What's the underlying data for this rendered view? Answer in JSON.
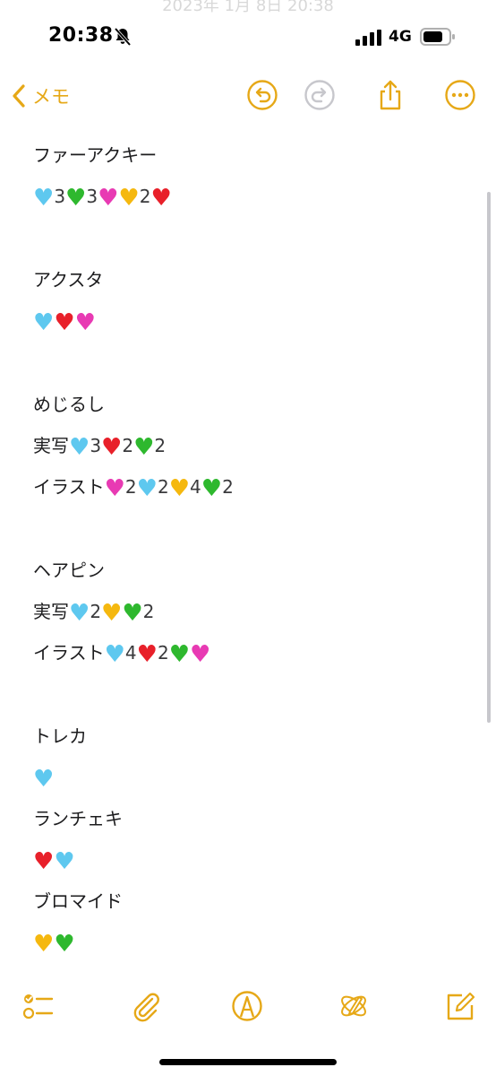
{
  "status_bar": {
    "time": "20:38",
    "network": "4G",
    "ghost_text": "2023年 1月 8日 20:38"
  },
  "nav": {
    "back_label": "メモ"
  },
  "colors": {
    "accent": "#e6a817",
    "heart_blue": "#5ec8ef",
    "heart_green": "#2eb82e",
    "heart_pink": "#e83ab3",
    "heart_yellow": "#f5b80f",
    "heart_red": "#e8202a"
  },
  "note": {
    "lines": [
      {
        "id": "l1",
        "text": "ファーアクキー"
      },
      {
        "id": "l2",
        "parts": [
          {
            "h": "blue"
          },
          {
            "n": "3"
          },
          {
            "h": "green"
          },
          {
            "n": "3"
          },
          {
            "h": "pink"
          },
          {
            "h": "yellow"
          },
          {
            "n": "2"
          },
          {
            "h": "red"
          }
        ]
      },
      {
        "id": "l3",
        "text": "アクスタ"
      },
      {
        "id": "l4",
        "parts": [
          {
            "h": "blue"
          },
          {
            "h": "red"
          },
          {
            "h": "pink"
          }
        ]
      },
      {
        "id": "l5",
        "text": "めじるし"
      },
      {
        "id": "l6",
        "label": "実写",
        "parts": [
          {
            "h": "blue"
          },
          {
            "n": "3"
          },
          {
            "h": "red"
          },
          {
            "n": "2"
          },
          {
            "h": "green"
          },
          {
            "n": "2"
          }
        ]
      },
      {
        "id": "l7",
        "label": "イラスト",
        "parts": [
          {
            "h": "pink"
          },
          {
            "n": "2"
          },
          {
            "h": "blue"
          },
          {
            "n": "2"
          },
          {
            "h": "yellow"
          },
          {
            "n": "4"
          },
          {
            "h": "green"
          },
          {
            "n": "2"
          }
        ]
      },
      {
        "id": "l8",
        "text": "ヘアピン"
      },
      {
        "id": "l9",
        "label": "実写",
        "parts": [
          {
            "h": "blue"
          },
          {
            "n": "2"
          },
          {
            "h": "yellow"
          },
          {
            "h": "green"
          },
          {
            "n": "2"
          }
        ]
      },
      {
        "id": "l10",
        "label": "イラスト",
        "parts": [
          {
            "h": "blue"
          },
          {
            "n": "4"
          },
          {
            "h": "red"
          },
          {
            "n": "2"
          },
          {
            "h": "green"
          },
          {
            "h": "pink"
          }
        ]
      },
      {
        "id": "l11",
        "text": "トレカ"
      },
      {
        "id": "l12",
        "parts": [
          {
            "h": "blue"
          }
        ]
      },
      {
        "id": "l13",
        "text": "ランチェキ"
      },
      {
        "id": "l14",
        "parts": [
          {
            "h": "red"
          },
          {
            "h": "blue"
          }
        ]
      },
      {
        "id": "l15",
        "text": "ブロマイド"
      },
      {
        "id": "l16",
        "parts": [
          {
            "h": "yellow"
          },
          {
            "h": "green"
          }
        ]
      }
    ]
  },
  "icons": {
    "bell": "bell-slash-icon",
    "back": "chevron-left-icon",
    "undo": "undo-icon",
    "redo": "redo-icon",
    "share": "share-icon",
    "more": "ellipsis-circle-icon",
    "checklist": "checklist-icon",
    "attach": "paperclip-icon",
    "markup": "markup-pen-icon",
    "ai": "writing-tools-icon",
    "compose": "compose-icon"
  }
}
